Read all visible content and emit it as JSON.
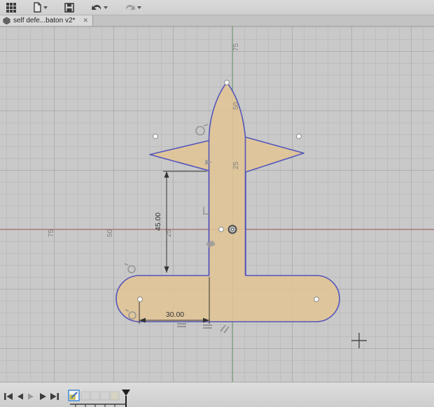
{
  "window": {
    "tab_title": "self defe...baton v2*",
    "close_glyph": "✕"
  },
  "toolbar": {
    "icons": [
      "app-grid-icon",
      "file-icon",
      "save-icon",
      "undo-icon",
      "redo-icon"
    ],
    "undo_enabled": true,
    "redo_enabled": false
  },
  "sketch": {
    "dimensions": {
      "vertical": "45.00",
      "horizontal": "30.00"
    },
    "axis_labels_x": [
      "75",
      "50",
      "25"
    ],
    "axis_labels_y": [
      "75",
      "50",
      "25"
    ],
    "constraint_icons": [
      "tangent-icon",
      "perpendicular-icon",
      "parallel-icon",
      "equal-icon",
      "coincident-icon"
    ]
  },
  "colors": {
    "canvas_bg": "#c9c9c9",
    "profile_fill": "#e0c496",
    "sketch_line": "#5456bb",
    "x_axis": "#a85c5c",
    "y_axis": "#6f9b6f",
    "dimension": "#333333",
    "timeline_highlight": "#4a90d9"
  },
  "timeline": {
    "controls": [
      "skip-start",
      "step-back",
      "step-forward",
      "play",
      "skip-end"
    ],
    "feature_icons": [
      "sketch-feature-icon",
      "feature-icon",
      "feature-icon",
      "feature-icon",
      "feature-icon"
    ]
  }
}
